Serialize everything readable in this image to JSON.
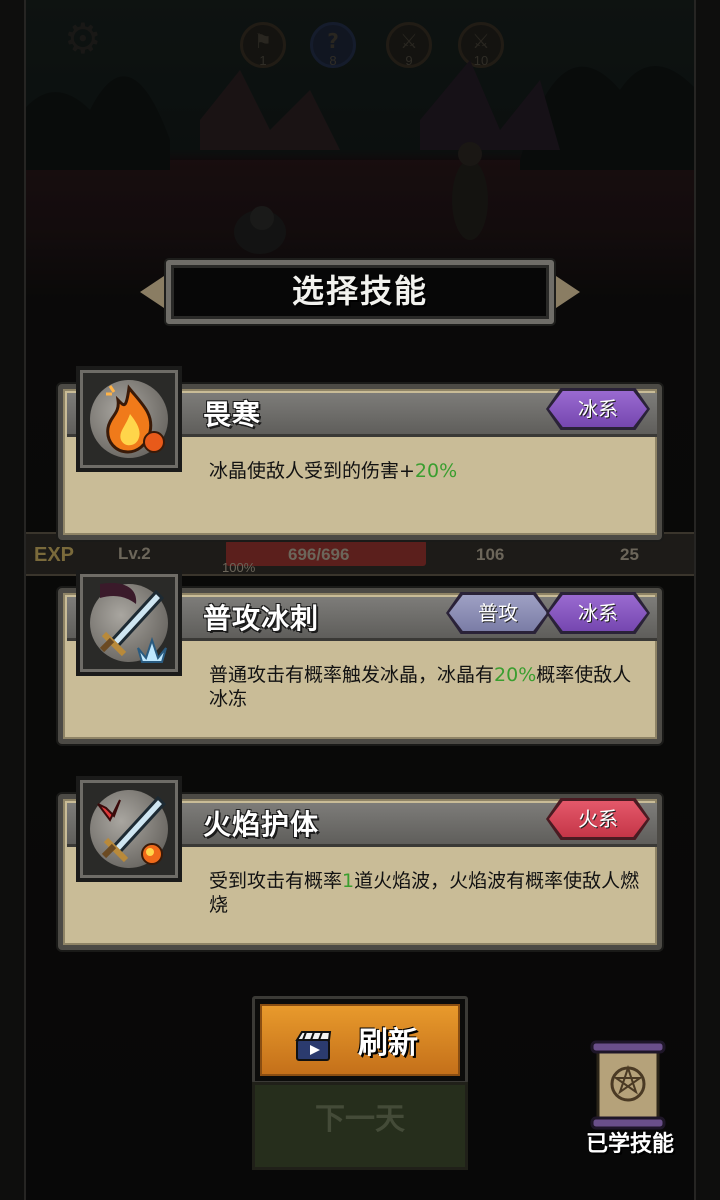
{
  "header": {
    "waves": [
      {
        "icon": "flag-icon",
        "number": "1"
      },
      {
        "icon": "question-icon",
        "number": "8"
      },
      {
        "icon": "swords-icon",
        "number": "9"
      },
      {
        "icon": "swords-icon",
        "number": "10"
      }
    ]
  },
  "hud": {
    "exp_label": "EXP",
    "level": "Lv.2",
    "hp": "696/696",
    "exp_percent": "100%",
    "attack": "106",
    "defense": "25"
  },
  "title": "选择技能",
  "skills": [
    {
      "name": "畏寒",
      "icon": "fire-orb-icon",
      "tags": [
        {
          "label": "冰系",
          "kind": "ice"
        }
      ],
      "desc_prefix": "冰晶使敌人受到的伤害+",
      "desc_highlight": "20%",
      "desc_suffix": ""
    },
    {
      "name": "普攻冰刺",
      "icon": "sword-ice-icon",
      "tags": [
        {
          "label": "普攻",
          "kind": "basic"
        },
        {
          "label": "冰系",
          "kind": "ice"
        }
      ],
      "desc_prefix": "普通攻击有概率触发冰晶，冰晶有",
      "desc_highlight": "20%",
      "desc_suffix": "概率使敌人冰冻"
    },
    {
      "name": "火焰护体",
      "icon": "sword-fire-icon",
      "tags": [
        {
          "label": "火系",
          "kind": "fire"
        }
      ],
      "desc_prefix": "受到攻击有概率",
      "desc_highlight": "1",
      "desc_suffix": "道火焰波，火焰波有概率使敌人燃烧"
    }
  ],
  "buttons": {
    "refresh": "刷新",
    "next_day": "下一天",
    "learned_skills": "已学技能"
  },
  "colors": {
    "highlight": "#3a9e2f",
    "ice_tag": "#8a5bc4",
    "basic_tag": "#8c8eb6",
    "fire_tag": "#d6455a",
    "refresh_button": "#e08a24"
  }
}
